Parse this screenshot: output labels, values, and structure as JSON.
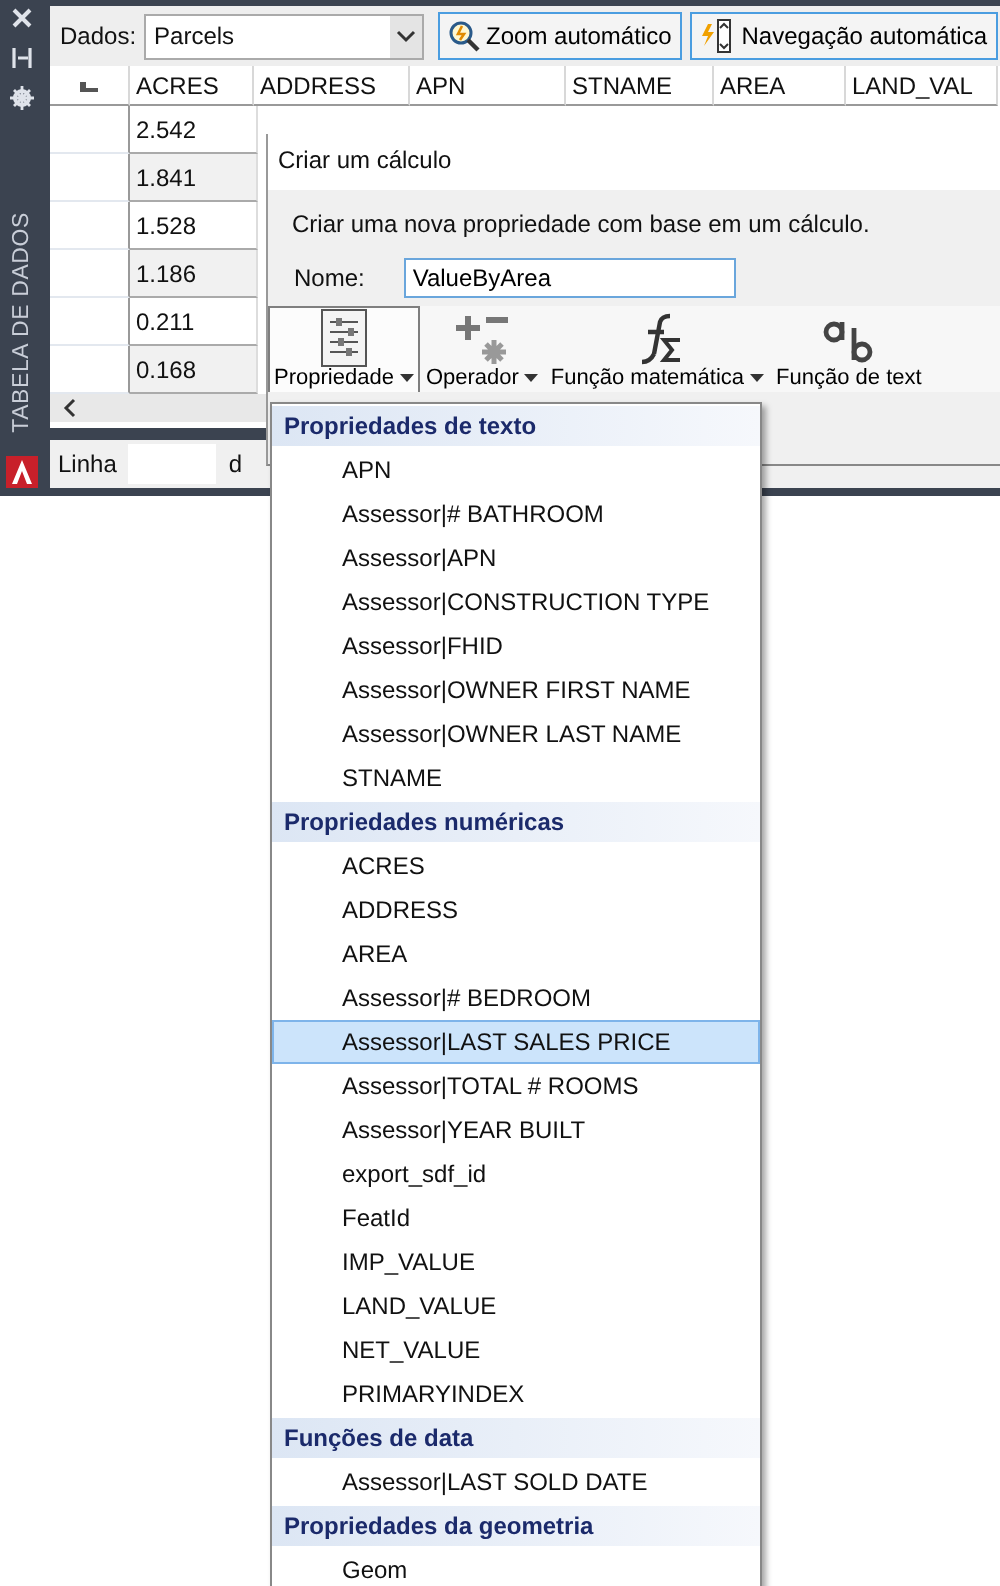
{
  "palette": {
    "title": "TABELA DE DADOS"
  },
  "toolbar": {
    "data_label": "Dados:",
    "data_source": "Parcels",
    "buttons": [
      "Zoom automático",
      "Navegação automática"
    ]
  },
  "table": {
    "columns": [
      "ACRES",
      "ADDRESS",
      "APN",
      "STNAME",
      "AREA",
      "LAND_VAL"
    ],
    "rows": [
      [
        "2.542"
      ],
      [
        "1.841"
      ],
      [
        "1.528"
      ],
      [
        "1.186"
      ],
      [
        "0.211"
      ],
      [
        "0.168"
      ]
    ]
  },
  "status_bar": {
    "row_label": "Linha",
    "column_2": "d"
  },
  "dialog": {
    "title": "Criar um cálculo",
    "description": "Criar uma nova propriedade com base em um cálculo.",
    "name_label": "Nome:",
    "name_value": "ValueByArea",
    "ribbon": [
      {
        "kind": "property",
        "label": "Propriedade",
        "selected": true,
        "dropdown": true
      },
      {
        "kind": "operator",
        "label": "Operador",
        "selected": false,
        "dropdown": true
      },
      {
        "kind": "math",
        "label": "Função matemática",
        "selected": false,
        "dropdown": true
      },
      {
        "kind": "text",
        "label": "Função de text",
        "selected": false,
        "dropdown": false
      }
    ]
  },
  "menu": {
    "sections": [
      {
        "title": "Propriedades de texto",
        "items": [
          {
            "label": "APN",
            "selected": false
          },
          {
            "label": "Assessor|# BATHROOM",
            "selected": false
          },
          {
            "label": "Assessor|APN",
            "selected": false
          },
          {
            "label": "Assessor|CONSTRUCTION TYPE",
            "selected": false
          },
          {
            "label": "Assessor|FHID",
            "selected": false
          },
          {
            "label": "Assessor|OWNER FIRST NAME",
            "selected": false
          },
          {
            "label": "Assessor|OWNER LAST NAME",
            "selected": false
          },
          {
            "label": "STNAME",
            "selected": false
          }
        ]
      },
      {
        "title": "Propriedades numéricas",
        "items": [
          {
            "label": "ACRES",
            "selected": false
          },
          {
            "label": "ADDRESS",
            "selected": false
          },
          {
            "label": "AREA",
            "selected": false
          },
          {
            "label": "Assessor|# BEDROOM",
            "selected": false
          },
          {
            "label": "Assessor|LAST SALES PRICE",
            "selected": true
          },
          {
            "label": "Assessor|TOTAL # ROOMS",
            "selected": false
          },
          {
            "label": "Assessor|YEAR BUILT",
            "selected": false
          },
          {
            "label": "export_sdf_id",
            "selected": false
          },
          {
            "label": "FeatId",
            "selected": false
          },
          {
            "label": "IMP_VALUE",
            "selected": false
          },
          {
            "label": "LAND_VALUE",
            "selected": false
          },
          {
            "label": "NET_VALUE",
            "selected": false
          },
          {
            "label": "PRIMARYINDEX",
            "selected": false
          }
        ]
      },
      {
        "title": "Funções de data",
        "items": [
          {
            "label": "Assessor|LAST SOLD DATE",
            "selected": false
          }
        ]
      },
      {
        "title": "Propriedades da geometria",
        "items": [
          {
            "label": "Geom",
            "selected": false
          }
        ]
      }
    ]
  }
}
